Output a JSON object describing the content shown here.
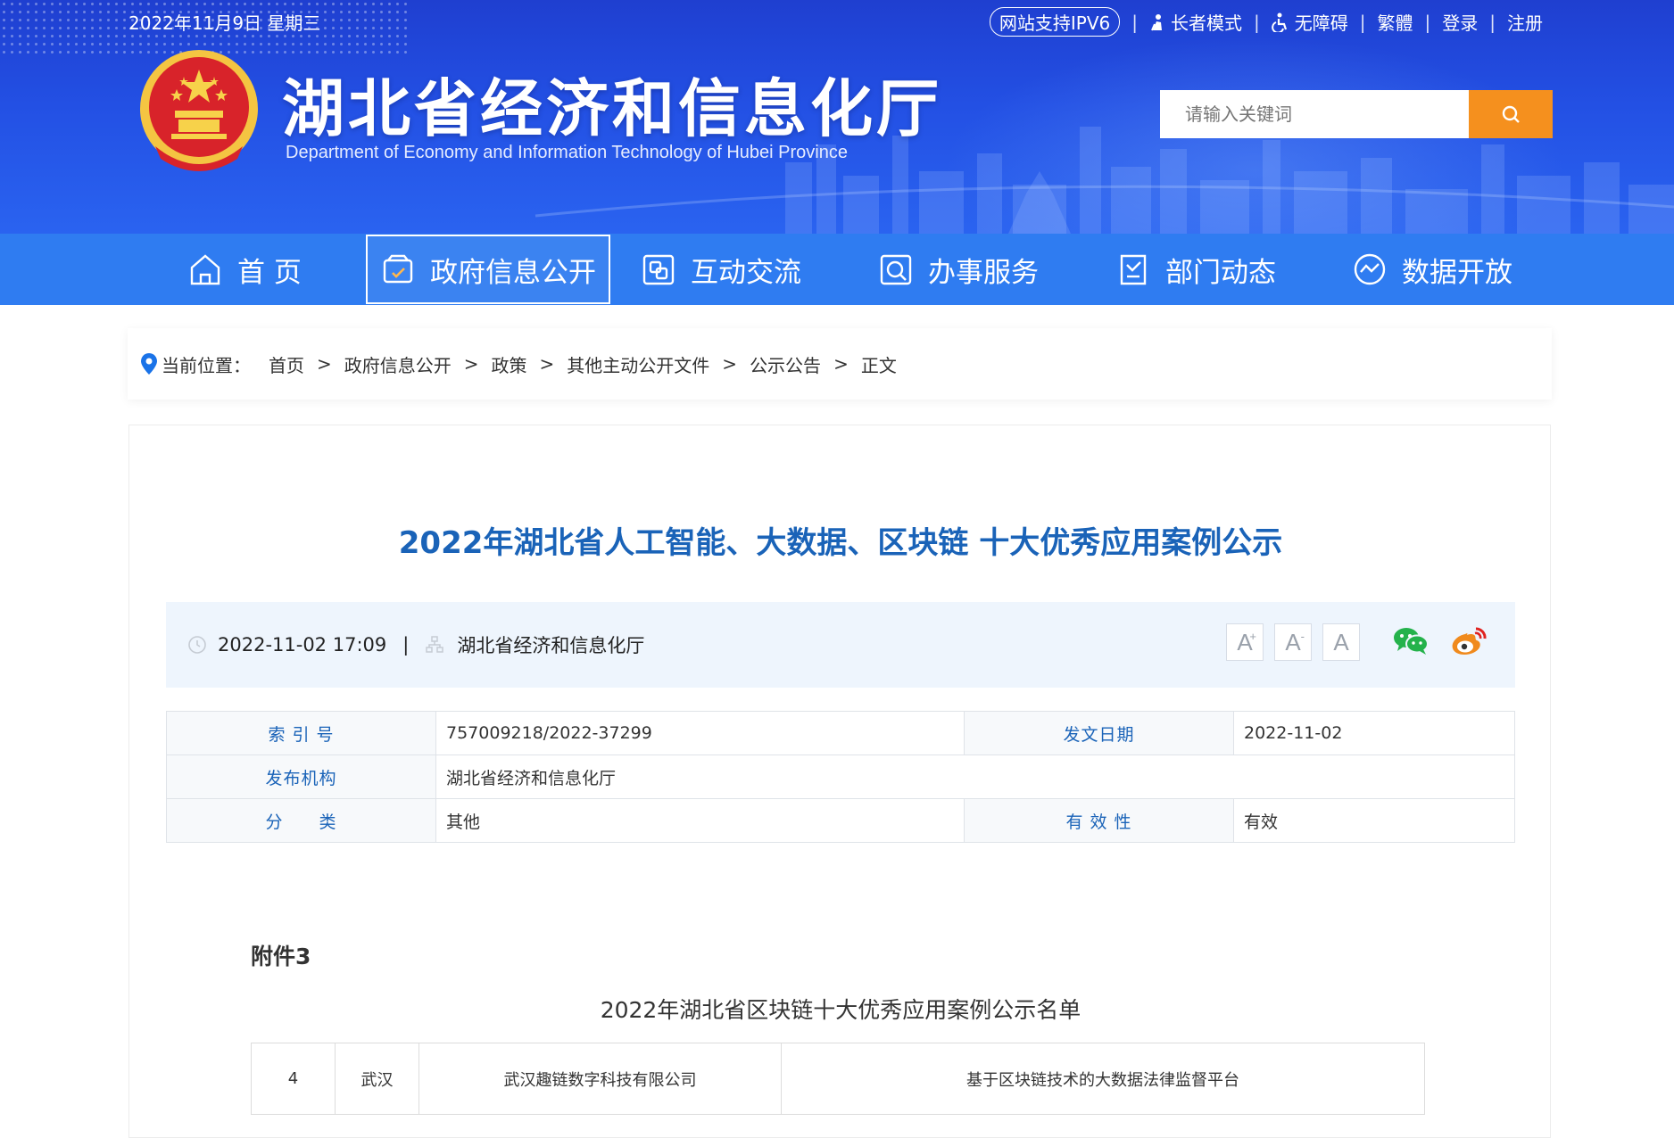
{
  "topbar": {
    "date": "2022年11月9日 星期三",
    "ipv6": "网站支持IPV6",
    "elder_mode": "长者模式",
    "accessibility": "无障碍",
    "traditional": "繁體",
    "login": "登录",
    "register": "注册"
  },
  "site": {
    "title": "湖北省经济和信息化厅",
    "subtitle": "Department of Economy and Information Technology of Hubei Province"
  },
  "search": {
    "placeholder": "请输入关键词"
  },
  "nav": {
    "items": [
      {
        "label": "首 页",
        "icon": "home-icon"
      },
      {
        "label": "政府信息公开",
        "icon": "info-disclosure-icon"
      },
      {
        "label": "互动交流",
        "icon": "interaction-icon"
      },
      {
        "label": "办事服务",
        "icon": "service-icon"
      },
      {
        "label": "部门动态",
        "icon": "news-icon"
      },
      {
        "label": "数据开放",
        "icon": "data-icon"
      }
    ],
    "active_index": 1
  },
  "breadcrumb": {
    "label": "当前位置：",
    "items": [
      "首页",
      "政府信息公开",
      "政策",
      "其他主动公开文件",
      "公示公告",
      "正文"
    ]
  },
  "article": {
    "title": "2022年湖北省人工智能、大数据、区块链 十大优秀应用案例公示",
    "datetime": "2022-11-02 17:09",
    "source": "湖北省经济和信息化厅",
    "font_buttons": [
      "A",
      "A",
      "A"
    ]
  },
  "info_table": {
    "index_label": "索 引 号",
    "index_value": "757009218/2022-37299",
    "date_label": "发文日期",
    "date_value": "2022-11-02",
    "publisher_label": "发布机构",
    "publisher_value": "湖北省经济和信息化厅",
    "category_label": "分　　类",
    "category_value": "其他",
    "validity_label": "有 效 性",
    "validity_value": "有效"
  },
  "attachment": {
    "label": "附件3",
    "list_title": "2022年湖北省区块链十大优秀应用案例公示名单",
    "rows": [
      {
        "no": "4",
        "city": "武汉",
        "company": "武汉趣链数字科技有限公司",
        "project": "基于区块链技术的大数据法律监督平台"
      }
    ]
  },
  "colors": {
    "header_blue": "#2350e4",
    "nav_blue": "#2f7cf1",
    "title_blue": "#1a63b8",
    "search_orange": "#f5901e",
    "meta_bg": "#eef5fd"
  }
}
